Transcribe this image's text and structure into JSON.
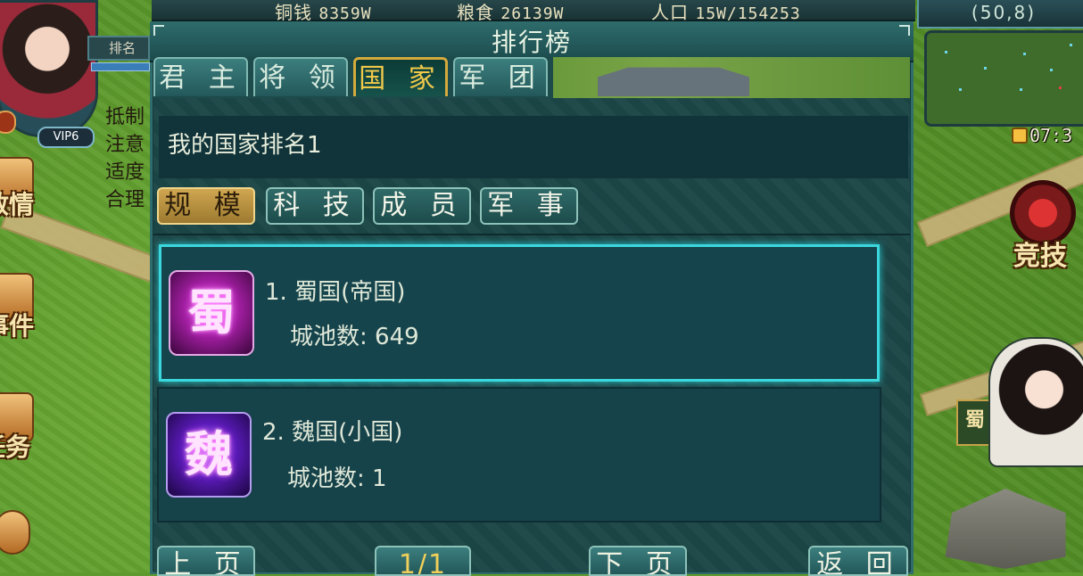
{
  "resources": [
    {
      "label": "铜钱",
      "value": "8359W"
    },
    {
      "label": "粮食",
      "value": "26139W"
    },
    {
      "label": "人口",
      "value": "15W/154253"
    }
  ],
  "player": {
    "vip": "VIP6",
    "rank_label": "排名"
  },
  "side_notes": [
    "抵制",
    "注意",
    "适度",
    "合理"
  ],
  "side_menu": [
    "敌情",
    "事件",
    "任务"
  ],
  "coordinates": "(50,8)",
  "clock": "07:3",
  "arena_label": "竞技",
  "kingdom_flag": "蜀",
  "panel": {
    "title": "排行榜",
    "tabs": [
      "君 主",
      "将 领",
      "国 家",
      "军 团"
    ],
    "active_tab": 2,
    "my_rank_text": "我的国家排名1",
    "subtabs": [
      "规 模",
      "科 技",
      "成 员",
      "军 事"
    ],
    "active_subtab": 0,
    "entries": [
      {
        "rank_name": "1. 蜀国(帝国)",
        "emblem": "蜀",
        "cities_label": "城池数:",
        "cities": "649",
        "emblem_color": "#c02dc0"
      },
      {
        "rank_name": "2. 魏国(小国)",
        "emblem": "魏",
        "cities_label": "城池数:",
        "cities": "1",
        "emblem_color": "#6a2ad0"
      }
    ],
    "nav": {
      "prev": "上 页",
      "page": "1/1",
      "next": "下 页",
      "back": "返 回"
    }
  }
}
